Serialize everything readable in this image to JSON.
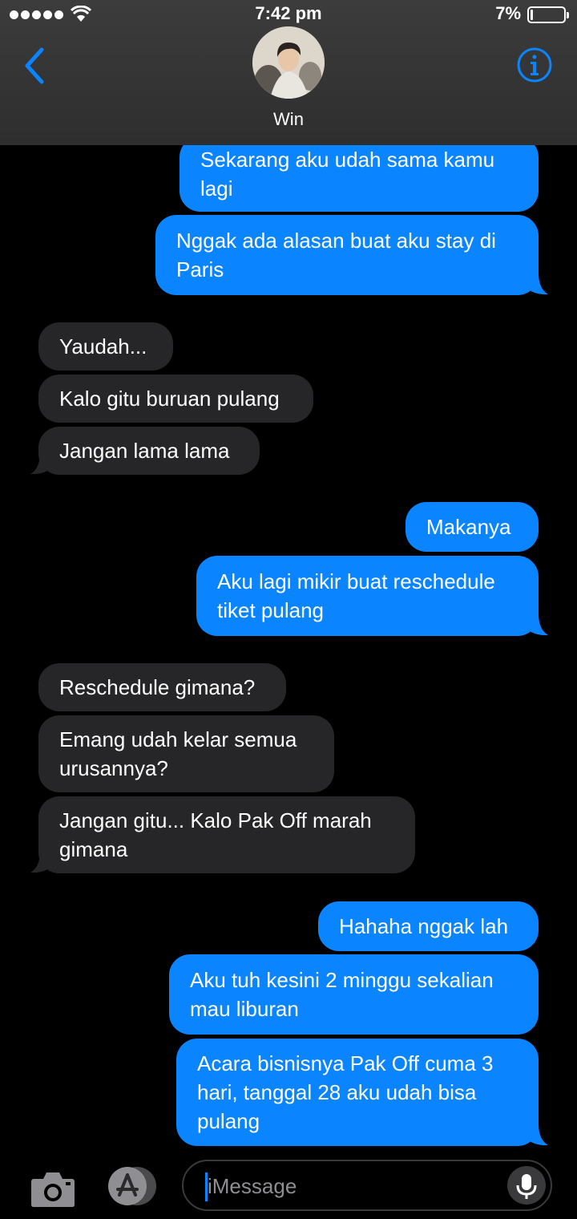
{
  "status_bar": {
    "time": "7:42 pm",
    "battery_percent": "7%",
    "battery_level": 0.07
  },
  "header": {
    "contact_name": "Win",
    "back_icon": "chevron-left-icon",
    "info_icon": "info-icon"
  },
  "messages": [
    {
      "from": "me",
      "text": "Sekarang aku udah sama kamu\nlagi"
    },
    {
      "from": "me",
      "text": "Nggak ada alasan buat aku stay di\nParis"
    },
    {
      "from": "them",
      "text": "Yaudah..."
    },
    {
      "from": "them",
      "text": "Kalo gitu buruan pulang"
    },
    {
      "from": "them",
      "text": "Jangan lama lama"
    },
    {
      "from": "me",
      "text": "Makanya"
    },
    {
      "from": "me",
      "text": "Aku lagi mikir buat reschedule\ntiket pulang"
    },
    {
      "from": "them",
      "text": "Reschedule gimana?"
    },
    {
      "from": "them",
      "text": "Emang udah kelar semua\nurusannya?"
    },
    {
      "from": "them",
      "text": "Jangan gitu... Kalo Pak Off marah\ngimana"
    },
    {
      "from": "me",
      "text": "Hahaha nggak lah"
    },
    {
      "from": "me",
      "text": "Aku tuh kesini 2 minggu sekalian\nmau liburan"
    },
    {
      "from": "me",
      "text": "Acara bisnisnya Pak Off cuma 3\nhari, tanggal 28 aku udah bisa\npulang"
    }
  ],
  "input": {
    "placeholder": "iMessage"
  },
  "colors": {
    "sent_bubble": "#0a84ff",
    "received_bubble": "#262628",
    "accent": "#0a84ff"
  }
}
